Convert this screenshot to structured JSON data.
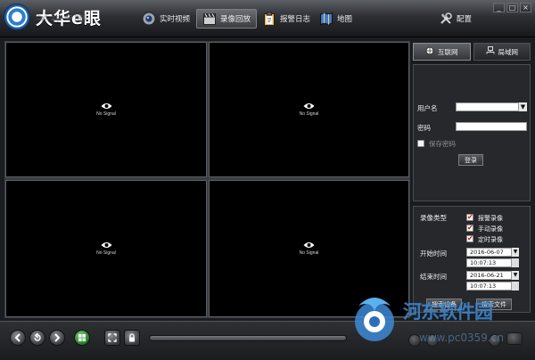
{
  "app": {
    "logo_text": "大华e眼",
    "logo_reflection": "大华e眼"
  },
  "nav": {
    "live": "实时视频",
    "playback": "录像回放",
    "alarm_log": "报警日志",
    "map": "地图",
    "config": "配置"
  },
  "window_buttons": {
    "minimize": "_",
    "maximize": "□",
    "close": "×"
  },
  "cells": [
    {
      "label": "No Signal"
    },
    {
      "label": "No Signal"
    },
    {
      "label": "No Signal"
    },
    {
      "label": "No Signal"
    }
  ],
  "right_tabs": {
    "internet": "互联网",
    "lan": "局域网"
  },
  "login": {
    "username_label": "用户名",
    "username_value": "",
    "password_label": "密码",
    "password_value": "",
    "remember_label": "保存密码",
    "remember_checked": false,
    "login_button": "登录"
  },
  "search": {
    "record_type_label": "录像类型",
    "types": [
      {
        "label": "报警录像",
        "checked": true
      },
      {
        "label": "手动录像",
        "checked": true
      },
      {
        "label": "定时录像",
        "checked": true
      }
    ],
    "start_label": "开始时间",
    "start_date": "2016-06-07",
    "start_time": "10:07:13",
    "end_label": "结束时间",
    "end_date": "2016-06-21",
    "end_time": "10:07:13",
    "search_device_button": "搜索设备",
    "search_file_button": "搜索文件"
  },
  "playback": {
    "progress": 0.0
  },
  "watermark": {
    "text": "河东软件园",
    "url": "www.pc0359.cn"
  },
  "colors": {
    "accent": "#3d8ad6",
    "checked_mark": "#c81616",
    "video_bg": "#000000"
  }
}
